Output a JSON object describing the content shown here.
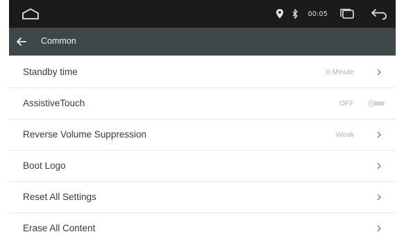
{
  "status_bar": {
    "time": "00:05",
    "icons": [
      "home-icon",
      "location-icon",
      "bluetooth-icon",
      "recents-icon",
      "back-icon"
    ]
  },
  "header": {
    "back_icon": "back-arrow-icon",
    "title": "Common",
    "background": "#3d4648"
  },
  "settings": {
    "rows": [
      {
        "label": "Standby time",
        "value": "0 Minute",
        "control": "chevron"
      },
      {
        "label": "AssistiveTouch",
        "value": "OFF",
        "control": "toggle"
      },
      {
        "label": "Reverse Volume Suppression",
        "value": "Weak",
        "control": "chevron"
      },
      {
        "label": "Boot Logo",
        "value": "",
        "control": "chevron"
      },
      {
        "label": "Reset All Settings",
        "value": "",
        "control": "chevron"
      },
      {
        "label": "Erase All Content",
        "value": "",
        "control": "chevron"
      }
    ]
  },
  "colors": {
    "status_bar": "#1b1b1b",
    "header": "#3d4648",
    "chevron": "#5a8a8a",
    "label": "#3a3a3a",
    "value": "#b0b0b0"
  }
}
